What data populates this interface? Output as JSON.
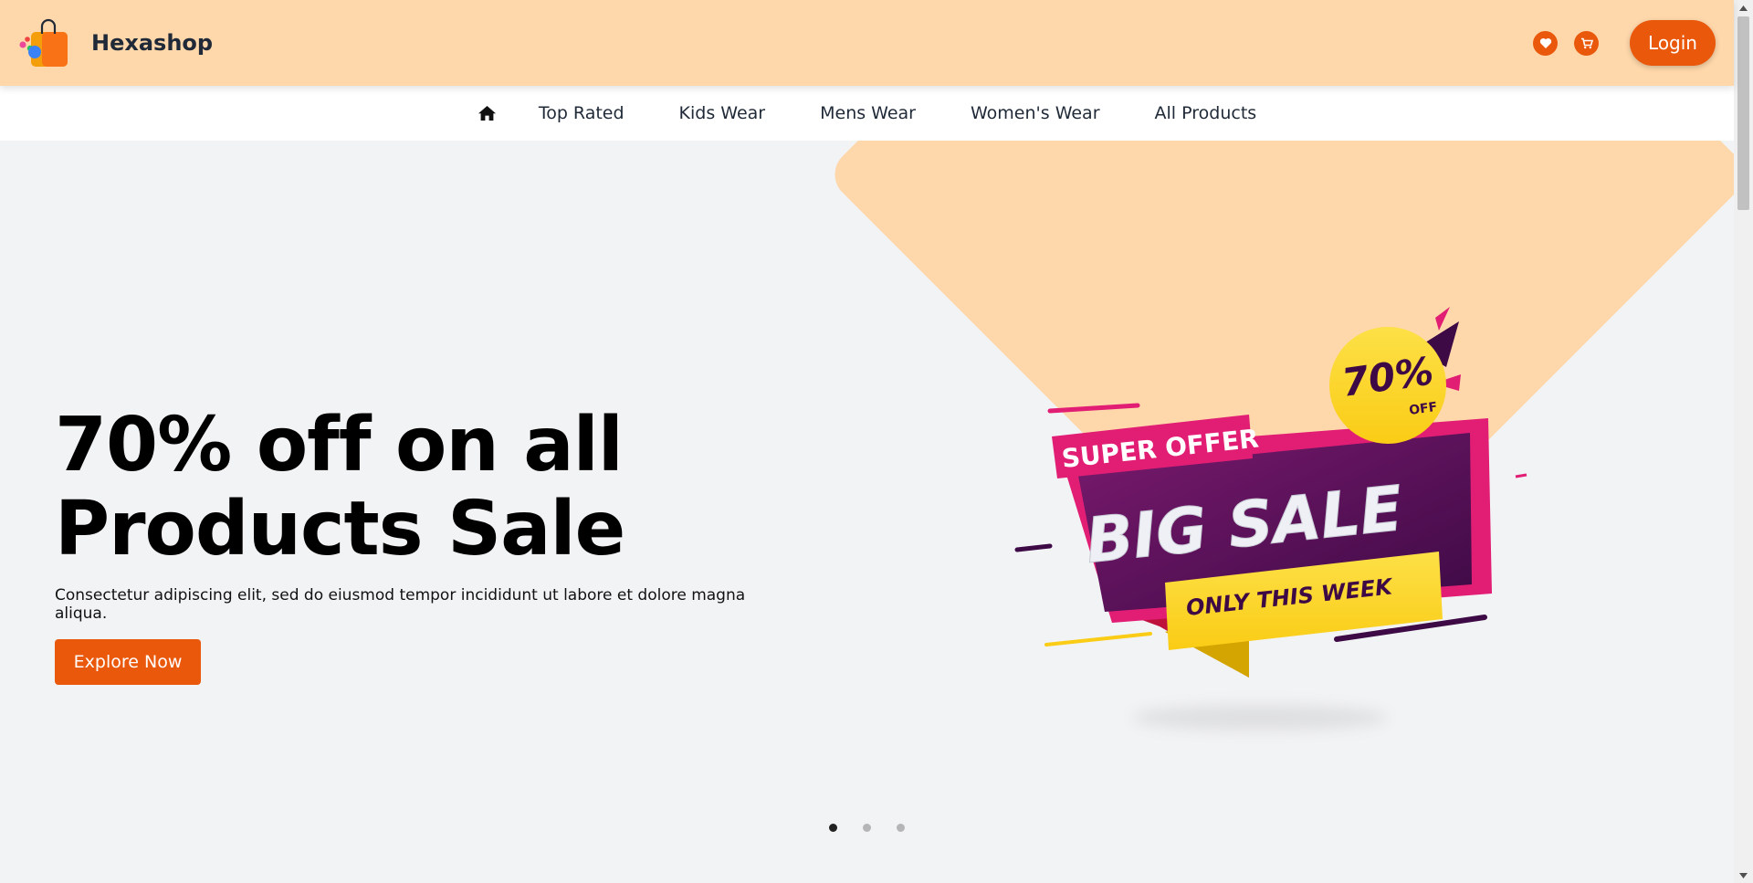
{
  "header": {
    "brand_name": "Hexashop",
    "login_label": "Login",
    "accent_color": "#ea580c",
    "background_color": "#fed7aa"
  },
  "nav": {
    "items": [
      {
        "label": "Top Rated"
      },
      {
        "label": "Kids Wear"
      },
      {
        "label": "Mens Wear"
      },
      {
        "label": "Women's Wear"
      },
      {
        "label": "All Products"
      }
    ]
  },
  "hero": {
    "title_line1": "70% off on all",
    "title_line2": "Products Sale",
    "subtitle": "Consectetur adipiscing elit, sed do eiusmod tempor incididunt ut labore et dolore magna aliqua.",
    "cta_label": "Explore Now",
    "promo": {
      "percent": "70%",
      "off": "OFF",
      "super_offer": "SUPER OFFER",
      "big_sale": "BIG SALE",
      "only_this_week": "ONLY THIS WEEK"
    },
    "carousel": {
      "total_slides": 3,
      "active_slide": 1
    }
  },
  "icons": {
    "logo": "shopping-bag-logo-icon",
    "wishlist": "heart-icon",
    "cart": "cart-icon",
    "home": "home-icon"
  }
}
